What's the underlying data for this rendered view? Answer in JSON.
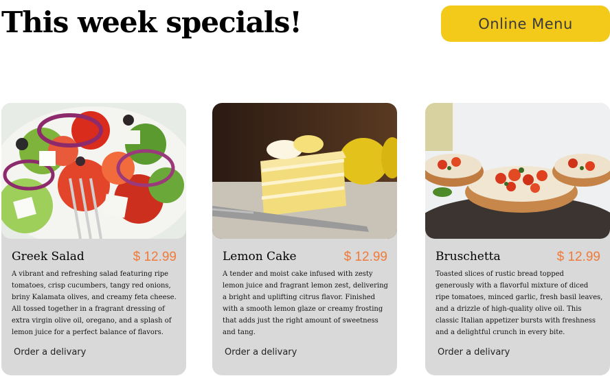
{
  "header": {
    "title": "This week specials!",
    "menu_button_label": "Online Menu"
  },
  "colors": {
    "accent": "#f3c91a",
    "price": "#f07a3a",
    "card_background": "#d9d9d9"
  },
  "cards": [
    {
      "image_icon": "greek-salad-photo",
      "name": "Greek Salad",
      "price": "$ 12.99",
      "description": "A vibrant and refreshing salad featuring ripe tomatoes, crisp cucumbers, tangy red onions, briny Kalamata olives, and creamy feta cheese. All tossed together in a fragrant dressing of extra virgin olive oil, oregano, and a splash of lemon juice for a perfect balance of flavors.",
      "order_label": "Order a delivary"
    },
    {
      "image_icon": "lemon-cake-photo",
      "name": "Lemon Cake",
      "price": "$ 12.99",
      "description": "A tender and moist cake infused with zesty lemon juice and fragrant lemon zest, delivering a bright and uplifting citrus flavor. Finished with a smooth lemon glaze or creamy frosting that adds just the right amount of sweetness and tang.",
      "order_label": "Order a delivary"
    },
    {
      "image_icon": "bruschetta-photo",
      "name": "Bruschetta",
      "price": "$ 12.99",
      "description": "Toasted slices of rustic bread topped generously with a flavorful mixture of diced ripe tomatoes, minced garlic, fresh basil leaves, and a drizzle of high-quality olive oil. This classic Italian appetizer bursts with freshness and a delightful crunch in every bite.",
      "order_label": "Order a delivary"
    }
  ]
}
